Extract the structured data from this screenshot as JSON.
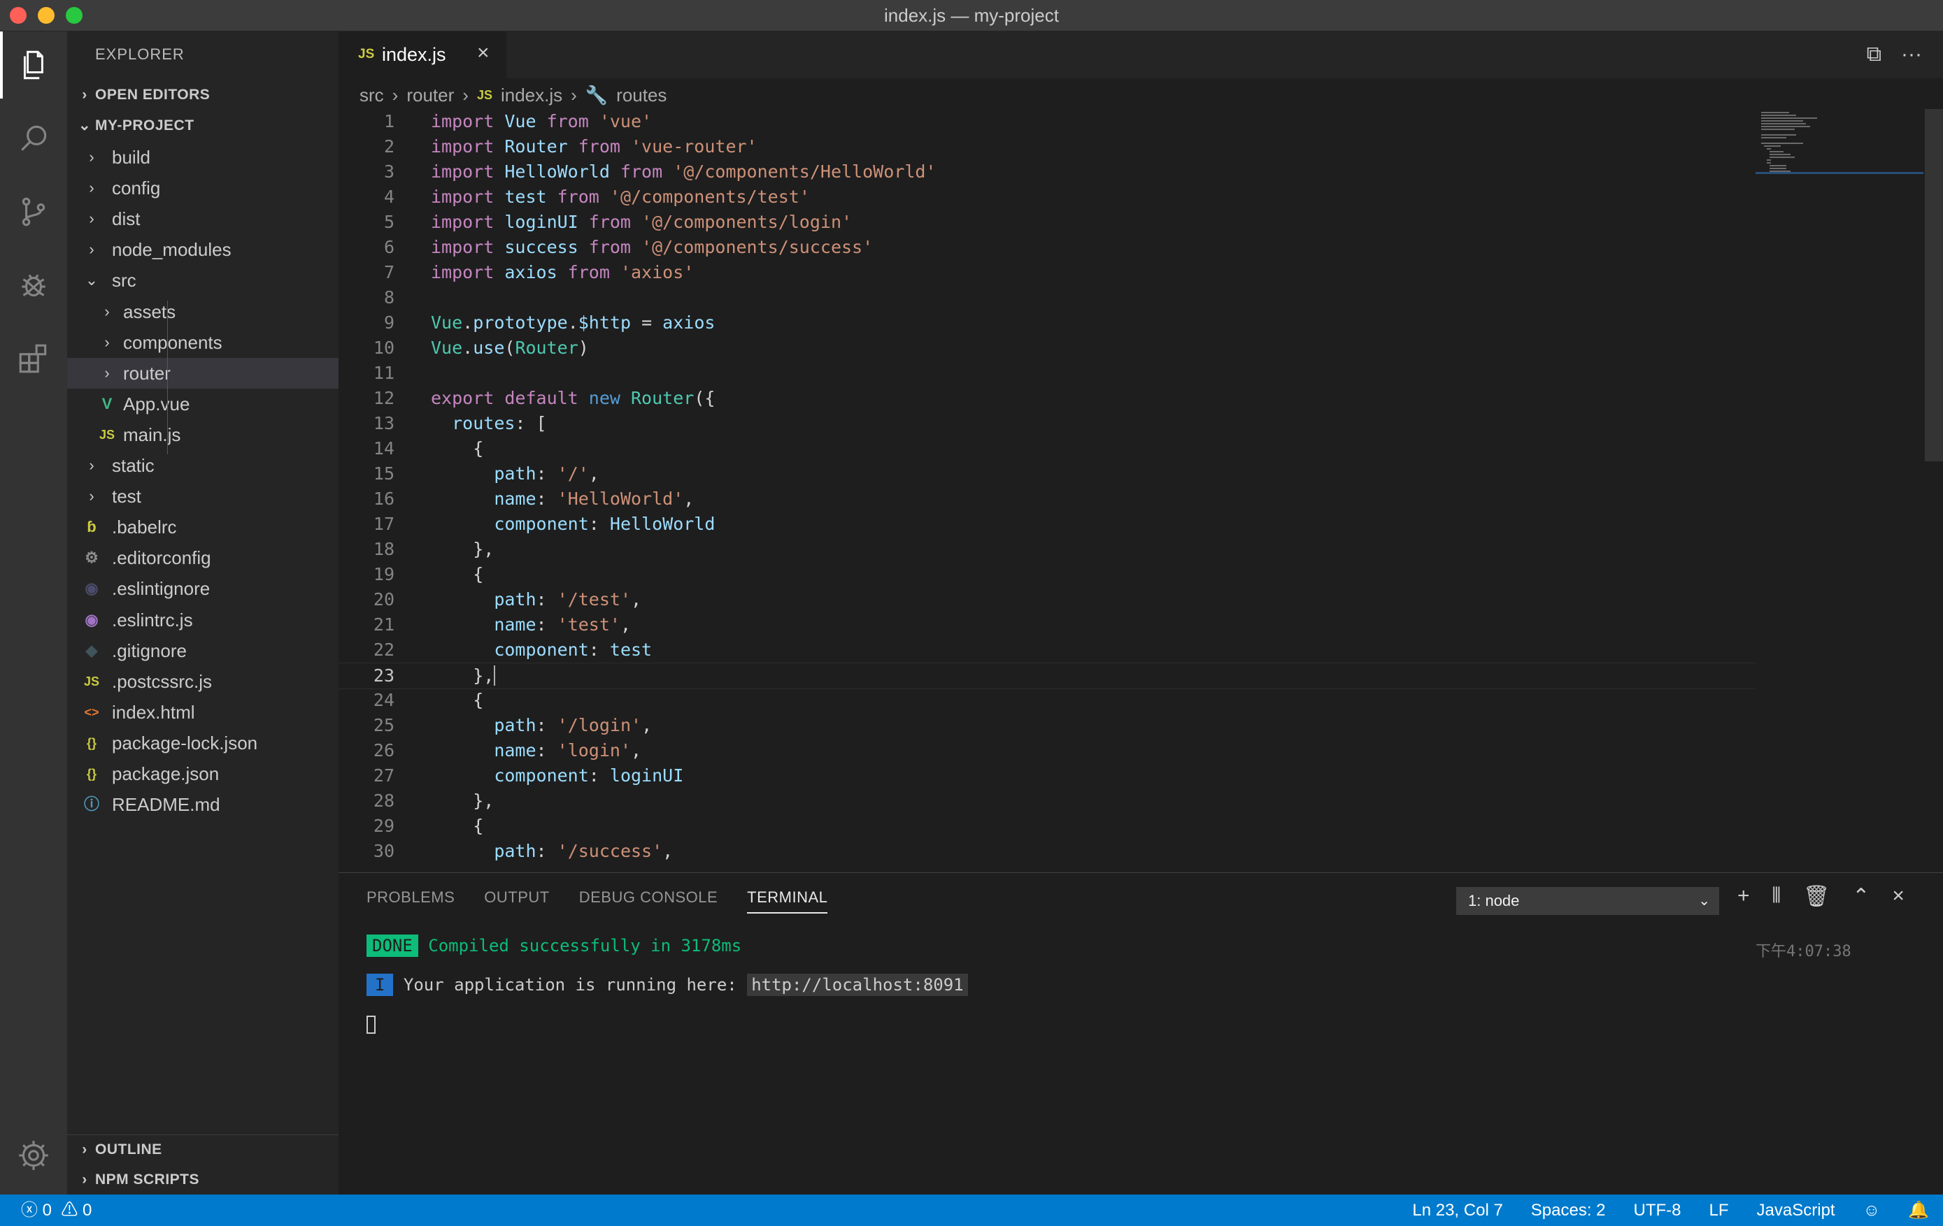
{
  "window": {
    "title": "index.js — my-project"
  },
  "activity": {
    "items": [
      "explorer-icon",
      "search-icon",
      "source-control-icon",
      "debug-icon",
      "extensions-icon"
    ],
    "settings": "gear-icon"
  },
  "sidebar": {
    "title": "EXPLORER",
    "open_editors": "OPEN EDITORS",
    "project": "MY-PROJECT",
    "tree": [
      {
        "name": "build",
        "icon": "›",
        "indent": 0
      },
      {
        "name": "config",
        "icon": "›",
        "indent": 0
      },
      {
        "name": "dist",
        "icon": "›",
        "indent": 0
      },
      {
        "name": "node_modules",
        "icon": "›",
        "indent": 0
      },
      {
        "name": "src",
        "icon": "⌄",
        "indent": 0
      },
      {
        "name": "assets",
        "icon": "›",
        "indent": 1
      },
      {
        "name": "components",
        "icon": "›",
        "indent": 1
      },
      {
        "name": "router",
        "icon": "›",
        "indent": 1,
        "selected": true
      },
      {
        "name": "App.vue",
        "icon": "V",
        "indent": 1,
        "color": "#41b883"
      },
      {
        "name": "main.js",
        "icon": "JS",
        "indent": 1,
        "color": "#cbcb41"
      },
      {
        "name": "static",
        "icon": "›",
        "indent": 0
      },
      {
        "name": "test",
        "icon": "›",
        "indent": 0
      },
      {
        "name": ".babelrc",
        "icon": "ɓ",
        "indent": 0,
        "color": "#cbcb41"
      },
      {
        "name": ".editorconfig",
        "icon": "⚙",
        "indent": 0,
        "color": "#8d8d8d"
      },
      {
        "name": ".eslintignore",
        "icon": "◉",
        "indent": 0,
        "color": "#4b4b6b"
      },
      {
        "name": ".eslintrc.js",
        "icon": "◉",
        "indent": 0,
        "color": "#a074c4"
      },
      {
        "name": ".gitignore",
        "icon": "◆",
        "indent": 0,
        "color": "#41535b"
      },
      {
        "name": ".postcssrc.js",
        "icon": "JS",
        "indent": 0,
        "color": "#cbcb41"
      },
      {
        "name": "index.html",
        "icon": "<>",
        "indent": 0,
        "color": "#e37933"
      },
      {
        "name": "package-lock.json",
        "icon": "{}",
        "indent": 0,
        "color": "#cbcb41"
      },
      {
        "name": "package.json",
        "icon": "{}",
        "indent": 0,
        "color": "#cbcb41"
      },
      {
        "name": "README.md",
        "icon": "ⓘ",
        "indent": 0,
        "color": "#519aba"
      }
    ],
    "outline": "OUTLINE",
    "npm_scripts": "NPM SCRIPTS"
  },
  "editor": {
    "tab": {
      "badge": "JS",
      "label": "index.js",
      "close": "×"
    },
    "actions": [
      "⧉",
      "···"
    ],
    "breadcrumb": {
      "a": "src",
      "b": "router",
      "badge": "JS",
      "c": "index.js",
      "d": "routes"
    },
    "lines": [
      {
        "n": "1",
        "t": [
          [
            "kw",
            "import "
          ],
          [
            "id",
            "Vue"
          ],
          [
            "kw",
            " from "
          ],
          [
            "st",
            "'vue'"
          ]
        ]
      },
      {
        "n": "2",
        "t": [
          [
            "kw",
            "import "
          ],
          [
            "id",
            "Router"
          ],
          [
            "kw",
            " from "
          ],
          [
            "st",
            "'vue-router'"
          ]
        ]
      },
      {
        "n": "3",
        "t": [
          [
            "kw",
            "import "
          ],
          [
            "id",
            "HelloWorld"
          ],
          [
            "kw",
            " from "
          ],
          [
            "st",
            "'@/components/HelloWorld'"
          ]
        ]
      },
      {
        "n": "4",
        "t": [
          [
            "kw",
            "import "
          ],
          [
            "id",
            "test"
          ],
          [
            "kw",
            " from "
          ],
          [
            "st",
            "'@/components/test'"
          ]
        ]
      },
      {
        "n": "5",
        "t": [
          [
            "kw",
            "import "
          ],
          [
            "id",
            "loginUI"
          ],
          [
            "kw",
            " from "
          ],
          [
            "st",
            "'@/components/login'"
          ]
        ]
      },
      {
        "n": "6",
        "t": [
          [
            "kw",
            "import "
          ],
          [
            "id",
            "success"
          ],
          [
            "kw",
            " from "
          ],
          [
            "st",
            "'@/components/success'"
          ]
        ]
      },
      {
        "n": "7",
        "t": [
          [
            "kw",
            "import "
          ],
          [
            "id",
            "axios"
          ],
          [
            "kw",
            " from "
          ],
          [
            "st",
            "'axios'"
          ]
        ]
      },
      {
        "n": "8",
        "t": []
      },
      {
        "n": "9",
        "t": [
          [
            "cl",
            "Vue"
          ],
          [
            "",
            "."
          ],
          [
            "id",
            "prototype"
          ],
          [
            "",
            "."
          ],
          [
            "id",
            "$http"
          ],
          [
            "",
            " = "
          ],
          [
            "id",
            "axios"
          ]
        ]
      },
      {
        "n": "10",
        "t": [
          [
            "cl",
            "Vue"
          ],
          [
            "",
            "."
          ],
          [
            "id",
            "use"
          ],
          [
            "",
            "("
          ],
          [
            "cl",
            "Router"
          ],
          [
            "",
            ")"
          ]
        ]
      },
      {
        "n": "11",
        "t": []
      },
      {
        "n": "12",
        "t": [
          [
            "kw",
            "export default "
          ],
          [
            "bl",
            "new "
          ],
          [
            "cl",
            "Router"
          ],
          [
            "",
            "({"
          ]
        ]
      },
      {
        "n": "13",
        "t": [
          [
            "",
            "  "
          ],
          [
            "id",
            "routes"
          ],
          [
            "",
            ": ["
          ]
        ]
      },
      {
        "n": "14",
        "t": [
          [
            "",
            "    {"
          ]
        ]
      },
      {
        "n": "15",
        "t": [
          [
            "",
            "      "
          ],
          [
            "id",
            "path"
          ],
          [
            "",
            ": "
          ],
          [
            "st",
            "'/'"
          ],
          [
            "",
            ","
          ]
        ]
      },
      {
        "n": "16",
        "t": [
          [
            "",
            "      "
          ],
          [
            "id",
            "name"
          ],
          [
            "",
            ": "
          ],
          [
            "st",
            "'HelloWorld'"
          ],
          [
            "",
            ","
          ]
        ]
      },
      {
        "n": "17",
        "t": [
          [
            "",
            "      "
          ],
          [
            "id",
            "component"
          ],
          [
            "",
            ": "
          ],
          [
            "id",
            "HelloWorld"
          ]
        ]
      },
      {
        "n": "18",
        "t": [
          [
            "",
            "    },"
          ]
        ]
      },
      {
        "n": "19",
        "t": [
          [
            "",
            "    {"
          ]
        ]
      },
      {
        "n": "20",
        "t": [
          [
            "",
            "      "
          ],
          [
            "id",
            "path"
          ],
          [
            "",
            ": "
          ],
          [
            "st",
            "'/test'"
          ],
          [
            "",
            ","
          ]
        ]
      },
      {
        "n": "21",
        "t": [
          [
            "",
            "      "
          ],
          [
            "id",
            "name"
          ],
          [
            "",
            ": "
          ],
          [
            "st",
            "'test'"
          ],
          [
            "",
            ","
          ]
        ]
      },
      {
        "n": "22",
        "t": [
          [
            "",
            "      "
          ],
          [
            "id",
            "component"
          ],
          [
            "",
            ": "
          ],
          [
            "id",
            "test"
          ]
        ]
      },
      {
        "n": "23",
        "t": [
          [
            "",
            "    },"
          ]
        ],
        "current": true
      },
      {
        "n": "24",
        "t": [
          [
            "",
            "    {"
          ]
        ]
      },
      {
        "n": "25",
        "t": [
          [
            "",
            "      "
          ],
          [
            "id",
            "path"
          ],
          [
            "",
            ": "
          ],
          [
            "st",
            "'/login'"
          ],
          [
            "",
            ","
          ]
        ]
      },
      {
        "n": "26",
        "t": [
          [
            "",
            "      "
          ],
          [
            "id",
            "name"
          ],
          [
            "",
            ": "
          ],
          [
            "st",
            "'login'"
          ],
          [
            "",
            ","
          ]
        ]
      },
      {
        "n": "27",
        "t": [
          [
            "",
            "      "
          ],
          [
            "id",
            "component"
          ],
          [
            "",
            ": "
          ],
          [
            "id",
            "loginUI"
          ]
        ]
      },
      {
        "n": "28",
        "t": [
          [
            "",
            "    },"
          ]
        ]
      },
      {
        "n": "29",
        "t": [
          [
            "",
            "    {"
          ]
        ]
      },
      {
        "n": "30",
        "t": [
          [
            "",
            "      "
          ],
          [
            "id",
            "path"
          ],
          [
            "",
            ": "
          ],
          [
            "st",
            "'/success'"
          ],
          [
            "",
            ","
          ]
        ]
      }
    ]
  },
  "panel": {
    "tabs": [
      "PROBLEMS",
      "OUTPUT",
      "DEBUG CONSOLE",
      "TERMINAL"
    ],
    "active_tab": "TERMINAL",
    "terminal_select": "1: node",
    "actions": [
      "+",
      "⫴",
      "🗑",
      "⌃",
      "×"
    ],
    "done_badge": "DONE",
    "compiled": "Compiled successfully in 3178ms",
    "timestamp": "下午4:07:38",
    "info_badge": "I",
    "running": "Your application is running here: ",
    "url": "http://localhost:8091"
  },
  "status": {
    "errors": "0",
    "warnings": "0",
    "position": "Ln 23, Col 7",
    "spaces": "Spaces: 2",
    "encoding": "UTF-8",
    "eol": "LF",
    "language": "JavaScript"
  }
}
